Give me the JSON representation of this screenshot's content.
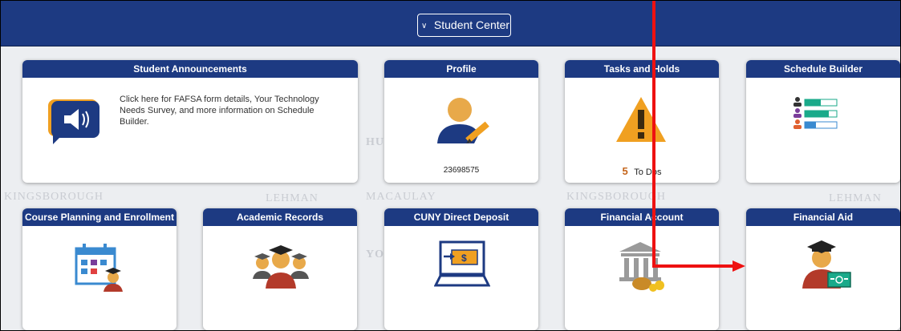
{
  "header": {
    "student_center_label": "Student Center"
  },
  "background_logos": [
    "KINGSBOROUGH",
    "LEHMAN",
    "MACAULAY",
    "KINGSBOROUGH",
    "LEHMAN",
    "HU",
    "YO"
  ],
  "tiles": {
    "announcements": {
      "title": "Student Announcements",
      "text": "Click here for FAFSA form details, Your Technology Needs Survey, and more information on Schedule Builder."
    },
    "profile": {
      "title": "Profile",
      "caption": "23698575"
    },
    "tasks": {
      "title": "Tasks and Holds",
      "count": "5",
      "count_label": "To Dos"
    },
    "schedule_builder": {
      "title": "Schedule Builder"
    },
    "course_planning": {
      "title": "Course Planning and Enrollment"
    },
    "academic_records": {
      "title": "Academic Records"
    },
    "direct_deposit": {
      "title": "CUNY Direct Deposit"
    },
    "financial_account": {
      "title": "Financial Account"
    },
    "financial_aid": {
      "title": "Financial Aid"
    }
  },
  "colors": {
    "header": "#1d3a82",
    "annotation_arrow": "#ee1111",
    "warning": "#f0a021",
    "todo_count": "#c4641a"
  }
}
